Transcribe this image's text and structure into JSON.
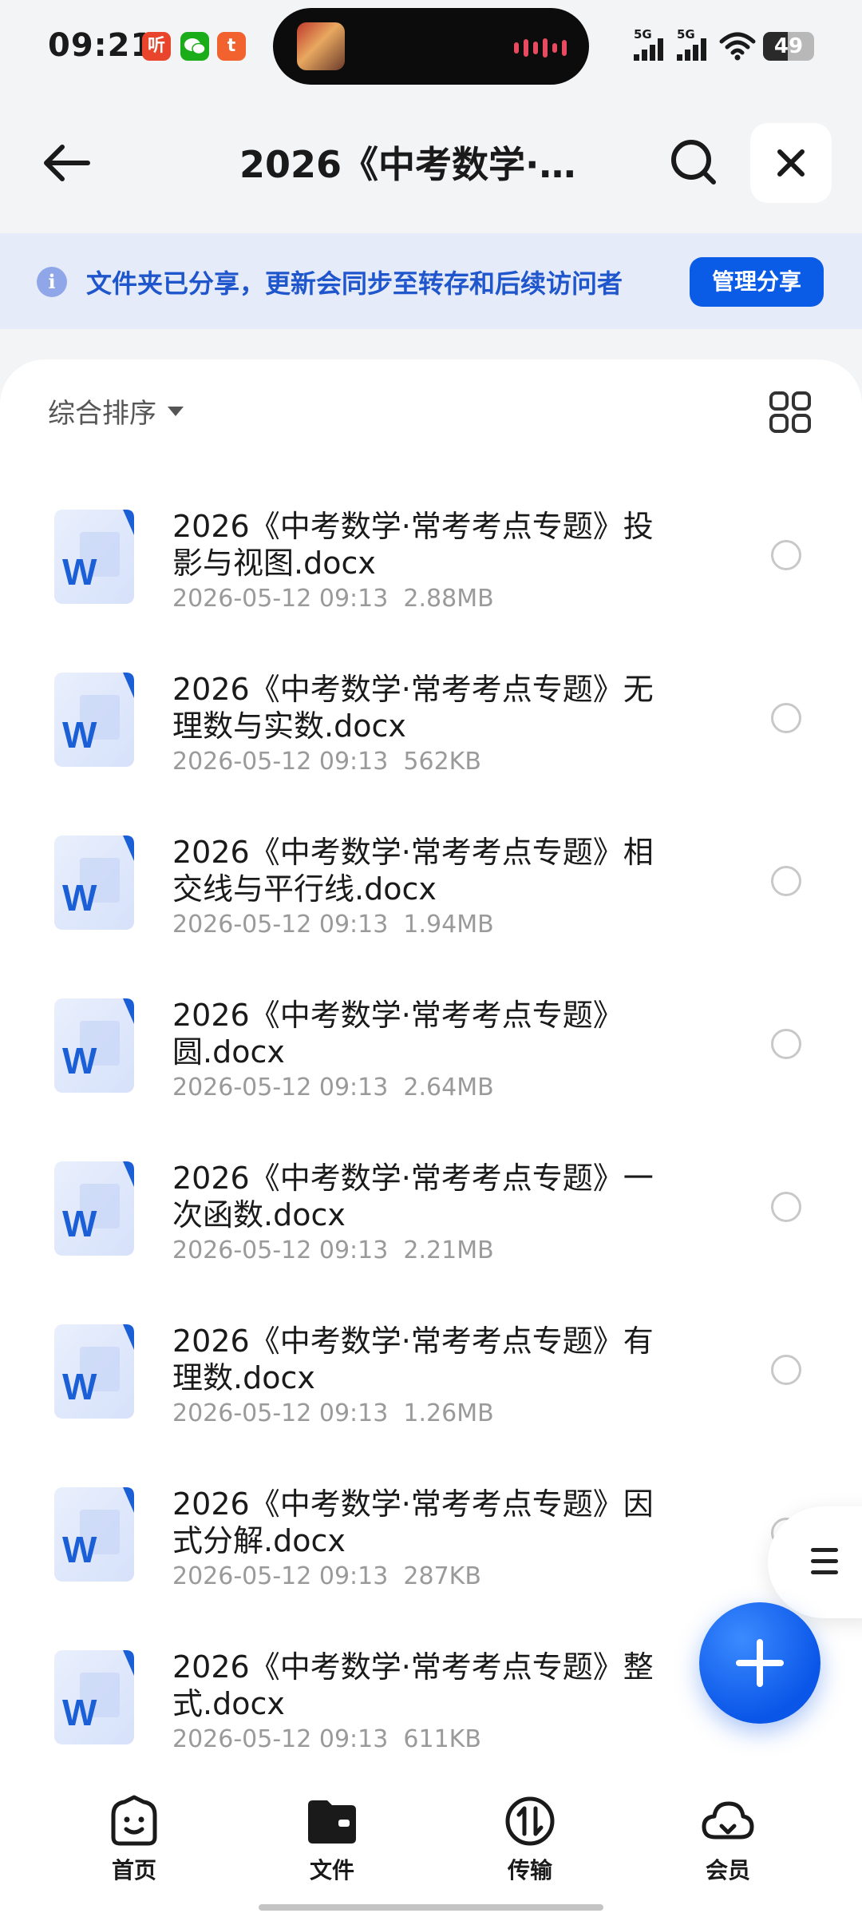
{
  "status_bar": {
    "time": "09:21",
    "apps": [
      {
        "icon": "listen-app-icon",
        "glyph": "听",
        "color": "#e8452c"
      },
      {
        "icon": "wechat-icon",
        "glyph": "●",
        "color": "#1aad19"
      },
      {
        "icon": "taobao-icon",
        "glyph": "t",
        "color": "#f2622e"
      }
    ],
    "signal_1": "5G",
    "signal_2": "5G",
    "battery": "49",
    "battery_level": 0.49
  },
  "header": {
    "title": "2026《中考数学·…"
  },
  "banner": {
    "text": "文件夹已分享，更新会同步至转存和后续访问者",
    "button": "管理分享"
  },
  "sort": {
    "label": "综合排序"
  },
  "files": [
    {
      "name": "2026《中考数学·常考考点专题》投影与视图.docx",
      "date": "2026-05-12 09:13",
      "size": "2.88MB"
    },
    {
      "name": "2026《中考数学·常考考点专题》无理数与实数.docx",
      "date": "2026-05-12 09:13",
      "size": "562KB"
    },
    {
      "name": "2026《中考数学·常考考点专题》相交线与平行线.docx",
      "date": "2026-05-12 09:13",
      "size": "1.94MB"
    },
    {
      "name": "2026《中考数学·常考考点专题》圆.docx",
      "date": "2026-05-12 09:13",
      "size": "2.64MB"
    },
    {
      "name": "2026《中考数学·常考考点专题》一次函数.docx",
      "date": "2026-05-12 09:13",
      "size": "2.21MB"
    },
    {
      "name": "2026《中考数学·常考考点专题》有理数.docx",
      "date": "2026-05-12 09:13",
      "size": "1.26MB"
    },
    {
      "name": "2026《中考数学·常考考点专题》因式分解.docx",
      "date": "2026-05-12 09:13",
      "size": "287KB"
    },
    {
      "name": "2026《中考数学·常考考点专题》整式.docx",
      "date": "2026-05-12 09:13",
      "size": "611KB"
    }
  ],
  "nav": {
    "home": "首页",
    "files": "文件",
    "transfer": "传输",
    "member": "会员"
  },
  "colors": {
    "accent": "#0a5be6",
    "banner_bg": "#e6ebfa",
    "banner_text": "#1f56cc"
  }
}
